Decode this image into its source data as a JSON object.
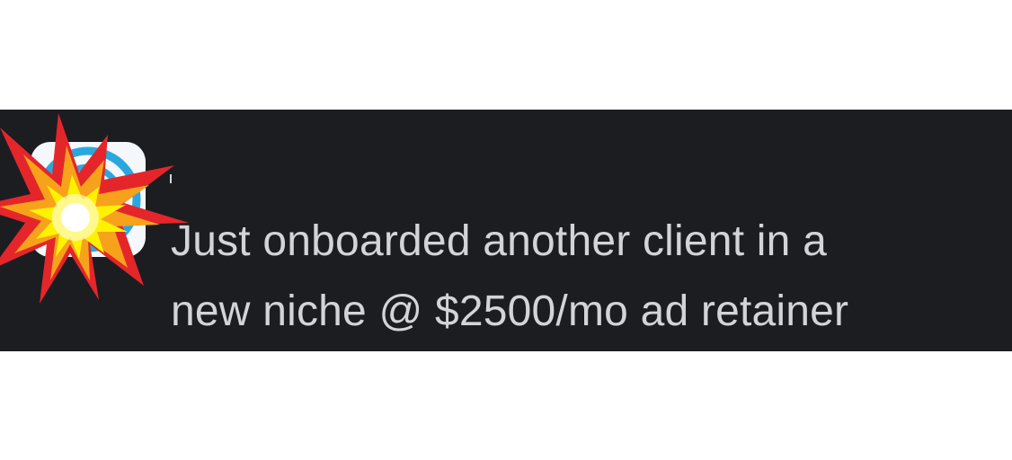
{
  "message": {
    "text": "Just onboarded another client in a\nnew niche @ $2500/mo ad retainer"
  },
  "avatar": {
    "icon": "app-logo-icon",
    "color": "#29a8e0"
  },
  "sticker": {
    "icon": "collision-burst-icon",
    "colors": [
      "#e4262b",
      "#f7a21b",
      "#fff200",
      "#ffffff"
    ]
  },
  "colors": {
    "banner_bg": "#1c1d21",
    "text": "#d3d4d7",
    "page_bg": "#ffffff"
  }
}
